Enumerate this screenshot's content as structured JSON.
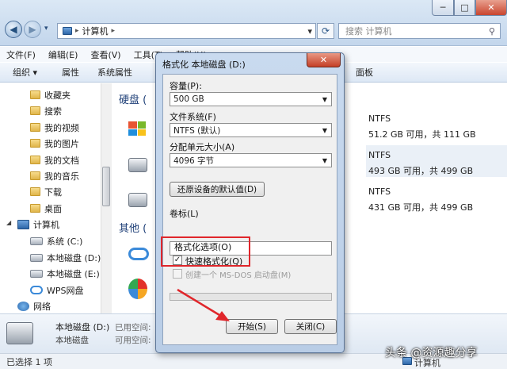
{
  "window": {
    "close_glyph": "✕",
    "min_glyph": "─",
    "max_glyph": "□"
  },
  "address": {
    "separator": "▸",
    "path": "计算机",
    "dropdown_glyph": "▾",
    "search_placeholder": "搜索 计算机"
  },
  "menubar": [
    "文件(F)",
    "编辑(E)",
    "查看(V)",
    "工具(T)",
    "帮助(H)"
  ],
  "cmdbar": {
    "organize": "组织 ▾",
    "properties": "属性",
    "system_properties": "系统属性",
    "control_panel": "面板"
  },
  "nav": {
    "items": [
      {
        "label": "收藏夹",
        "icon": "folder-icon"
      },
      {
        "label": "搜索",
        "icon": "folder-icon"
      },
      {
        "label": "我的视频",
        "icon": "folder-icon"
      },
      {
        "label": "我的图片",
        "icon": "folder-icon"
      },
      {
        "label": "我的文档",
        "icon": "folder-icon"
      },
      {
        "label": "我的音乐",
        "icon": "folder-icon"
      },
      {
        "label": "下载",
        "icon": "folder-icon"
      },
      {
        "label": "桌面",
        "icon": "folder-icon"
      },
      {
        "label": "计算机",
        "icon": "computer-icon"
      },
      {
        "label": "系统 (C:)",
        "icon": "drive-icon"
      },
      {
        "label": "本地磁盘 (D:)",
        "icon": "drive-icon"
      },
      {
        "label": "本地磁盘 (E:)",
        "icon": "drive-icon"
      },
      {
        "label": "WPS网盘",
        "icon": "cloud-icon"
      },
      {
        "label": "网络",
        "icon": "network-icon"
      }
    ]
  },
  "content": {
    "section_disks": "硬盘 (",
    "section_other": "其他 (",
    "drives": [
      {
        "fs": "NTFS",
        "space": "51.2 GB 可用，共 111 GB",
        "used_fraction": 0.54
      },
      {
        "fs": "NTFS",
        "space": "493 GB 可用，共 499 GB",
        "used_fraction": 0.012
      },
      {
        "fs": "NTFS",
        "space": "431 GB 可用，共 499 GB",
        "used_fraction": 0.14
      }
    ]
  },
  "details": {
    "name": "本地磁盘 (D:)",
    "type": "本地磁盘",
    "used_label": "已用空间:",
    "free_label": "可用空间:"
  },
  "status": {
    "text": "已选择 1 项",
    "computer_label": "计算机"
  },
  "dialog": {
    "title": "格式化 本地磁盘 (D:)",
    "close_glyph": "✕",
    "capacity_label": "容量(P):",
    "capacity_value": "500 GB",
    "fs_label": "文件系统(F)",
    "fs_value": "NTFS (默认)",
    "alloc_label": "分配单元大小(A)",
    "alloc_value": "4096 字节",
    "restore_button": "还原设备的默认值(D)",
    "volume_label": "卷标(L)",
    "volume_value": "",
    "format_options_label": "格式化选项(O)",
    "quick_format_label": "快速格式化(Q)",
    "quick_format_checked": true,
    "msdos_label": "创建一个 MS-DOS 启动盘(M)",
    "msdos_checked": false,
    "progress_fraction": 0,
    "start_button": "开始(S)",
    "close_button": "关闭(C)",
    "check_glyph": "✓",
    "combo_arrow": "▼"
  },
  "watermark": "头条 @资源趣分享",
  "colors": {
    "annotation_red": "#e0262b",
    "title_blue": "#1e3f77",
    "bar_blue": "#2f79c4"
  }
}
